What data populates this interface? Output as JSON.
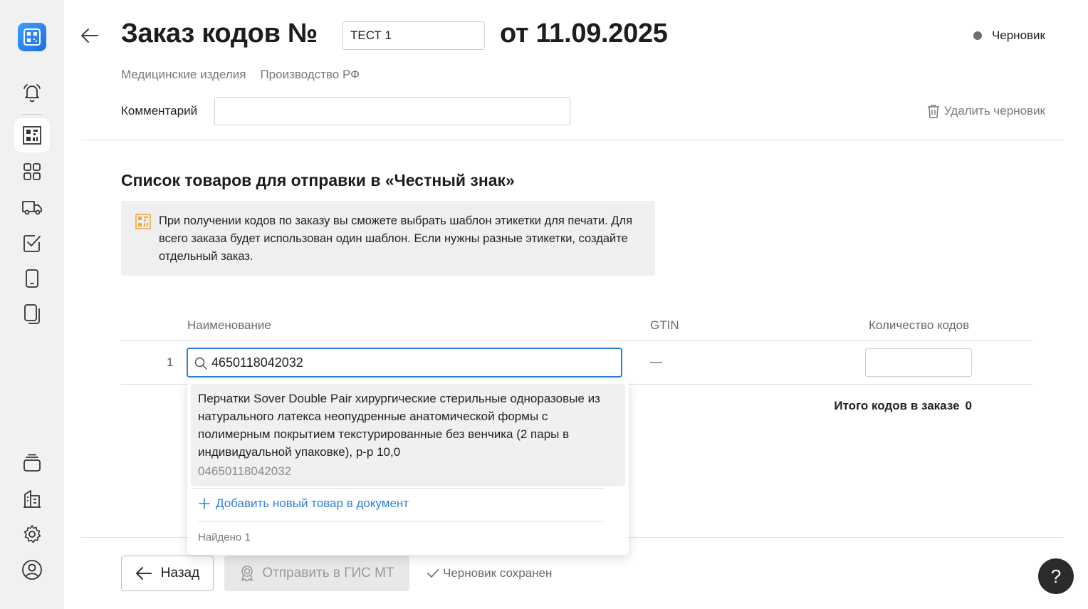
{
  "sidebar": {
    "items": [
      {
        "icon": "bell-icon"
      },
      {
        "icon": "qr-code-icon",
        "active": true
      },
      {
        "icon": "grid-icon"
      },
      {
        "icon": "truck-icon"
      },
      {
        "icon": "checkbox-icon"
      },
      {
        "icon": "phone-icon"
      },
      {
        "icon": "documents-icon"
      }
    ],
    "bottom_items": [
      {
        "icon": "stack-icon"
      },
      {
        "icon": "building-icon"
      },
      {
        "icon": "gear-icon"
      },
      {
        "icon": "user-icon"
      }
    ]
  },
  "header": {
    "title_prefix": "Заказ кодов №",
    "order_number": "ТЕСТ 1",
    "title_date": "от 11.09.2025",
    "status": "Черновик",
    "tags": [
      "Медицинские изделия",
      "Производство РФ"
    ],
    "comment_label": "Комментарий",
    "comment_value": "",
    "delete_label": "Удалить черновик"
  },
  "goods": {
    "title": "Список товаров для отправки в «Честный знак»",
    "info": "При получении кодов по заказу вы сможете выбрать шаблон этикетки для печати. Для всего заказа будет использован один шаблон. Если нужны разные этикетки, создайте отдельный заказ.",
    "columns": [
      "Наименование",
      "GTIN",
      "Количество кодов"
    ],
    "rows": [
      {
        "num": "1",
        "search_value": "4650118042032",
        "gtin": "—",
        "quantity": ""
      }
    ],
    "total_label": "Итого кодов в заказе",
    "total_value": "0"
  },
  "dropdown": {
    "results": [
      {
        "title": "Перчатки Sover Double Pair хирургические стерильные одноразовые из натурального латекса неопудренные анатомической формы с полимерным покрытием текстурированные без венчика (2 пары в индивидуальной упаковке), р-р 10,0",
        "code": "04650118042032"
      }
    ],
    "add_label": "Добавить новый товар в документ",
    "found_label": "Найдено 1"
  },
  "footer": {
    "back_label": "Назад",
    "send_label": "Отправить в ГИС МТ",
    "saved_label": "Черновик сохранен",
    "help_label": "?"
  },
  "colors": {
    "accent": "#2f7fd8",
    "info_icon": "#f2a93b",
    "status_dot": "#6e6e6e"
  }
}
